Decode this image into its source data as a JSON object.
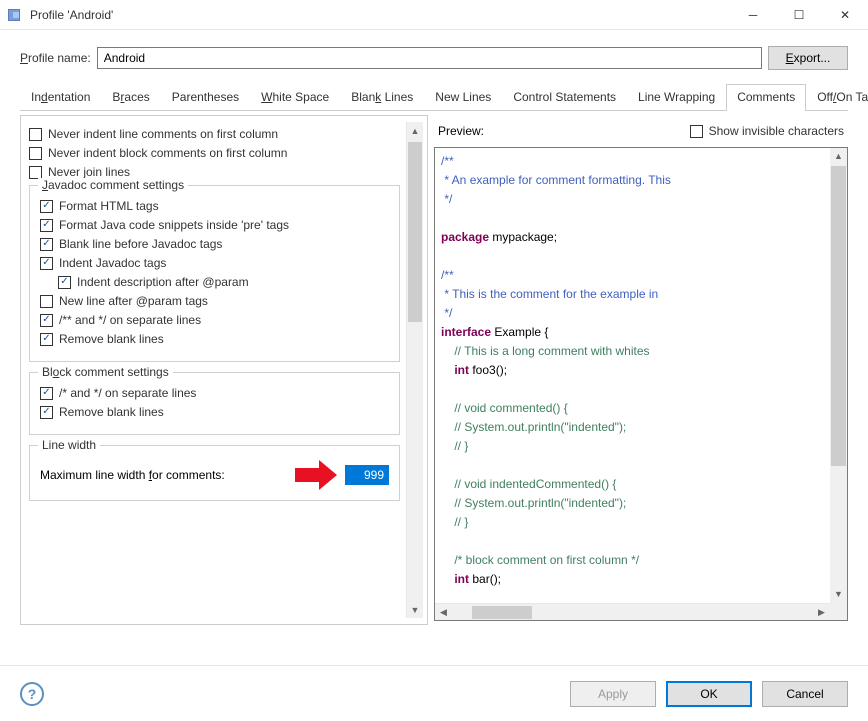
{
  "window": {
    "title": "Profile 'Android'"
  },
  "profile": {
    "label": "Profile name:",
    "value": "Android",
    "export": "Export..."
  },
  "tabs": [
    "Indentation",
    "Braces",
    "Parentheses",
    "White Space",
    "Blank Lines",
    "New Lines",
    "Control Statements",
    "Line Wrapping",
    "Comments",
    "Off/On Tags"
  ],
  "active_tab": "Comments",
  "left": {
    "plain": {
      "c1": "Never indent line comments on first column",
      "c2": "Never indent block comments on first column",
      "c3": "Never join lines"
    },
    "javadoc": {
      "legend": "Javadoc comment settings",
      "c1": "Format HTML tags",
      "c2": "Format Java code snippets inside 'pre' tags",
      "c3": "Blank line before Javadoc tags",
      "c4": "Indent Javadoc tags",
      "c4a": "Indent description after @param",
      "c5": "New line after @param tags",
      "c6": "/** and */ on separate lines",
      "c7": "Remove blank lines"
    },
    "block": {
      "legend": "Block comment settings",
      "c1": "/* and */ on separate lines",
      "c2": "Remove blank lines"
    },
    "linewidth": {
      "legend": "Line width",
      "label": "Maximum line width for comments:",
      "value": "999"
    }
  },
  "preview": {
    "label": "Preview:",
    "show_invisible": "Show invisible characters",
    "lines": [
      {
        "cls": "c-docstar",
        "t": "/**"
      },
      {
        "cls": "c-docstar",
        "t": " * An example for comment formatting. This"
      },
      {
        "cls": "c-docstar",
        "t": " */"
      },
      {
        "cls": "",
        "t": ""
      },
      {
        "cls": "",
        "t": "",
        "kw": "package",
        "rest": " mypackage;"
      },
      {
        "cls": "",
        "t": ""
      },
      {
        "cls": "c-docstar",
        "t": "/**"
      },
      {
        "cls": "c-docstar",
        "t": " * This is the comment for the example in"
      },
      {
        "cls": "c-docstar",
        "t": " */"
      },
      {
        "cls": "",
        "t": "",
        "kw": "interface",
        "rest": " Example {"
      },
      {
        "cls": "c-comment",
        "t": "    // This is a long comment with whites"
      },
      {
        "cls": "",
        "t": "    ",
        "kw": "int",
        "rest": " foo3();"
      },
      {
        "cls": "",
        "t": ""
      },
      {
        "cls": "c-comment",
        "t": "    // void commented() {"
      },
      {
        "cls": "c-comment",
        "t": "    // System.out.println(\"indented\");"
      },
      {
        "cls": "c-comment",
        "t": "    // }"
      },
      {
        "cls": "",
        "t": ""
      },
      {
        "cls": "c-comment",
        "t": "    // void indentedCommented() {"
      },
      {
        "cls": "c-comment",
        "t": "    // System.out.println(\"indented\");"
      },
      {
        "cls": "c-comment",
        "t": "    // }"
      },
      {
        "cls": "",
        "t": ""
      },
      {
        "cls": "c-comment",
        "t": "    /* block comment on first column */"
      },
      {
        "cls": "",
        "t": "    ",
        "kw": "int",
        "rest": " bar();"
      }
    ]
  },
  "footer": {
    "apply": "Apply",
    "ok": "OK",
    "cancel": "Cancel"
  }
}
